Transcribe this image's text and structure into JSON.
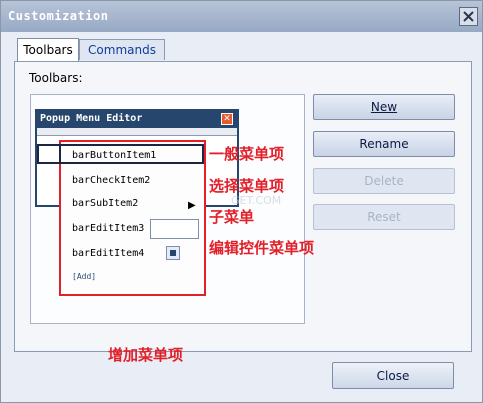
{
  "window": {
    "title": "Customization"
  },
  "tabs": [
    {
      "label": "Toolbars"
    },
    {
      "label": "Commands"
    }
  ],
  "panel": {
    "label": "Toolbars:"
  },
  "buttons": {
    "new": "New",
    "rename": "Rename",
    "delete": "Delete",
    "reset": "Reset",
    "close": "Close"
  },
  "popup": {
    "title": "Popup Menu Editor",
    "items": [
      "barButtonItem1",
      "barCheckItem2",
      "barSubItem2",
      "barEditItem3",
      "barEditItem4"
    ],
    "add": "[Add]"
  },
  "annotations": {
    "general": "一般菜单项",
    "choice": "选择菜单项",
    "submenu": "子菜单",
    "edit": "编辑控件菜单项",
    "add": "增加菜单项"
  },
  "watermark": "GET.COM",
  "colors": {
    "accent": "#e2202a",
    "titlebar": "#26466d"
  }
}
